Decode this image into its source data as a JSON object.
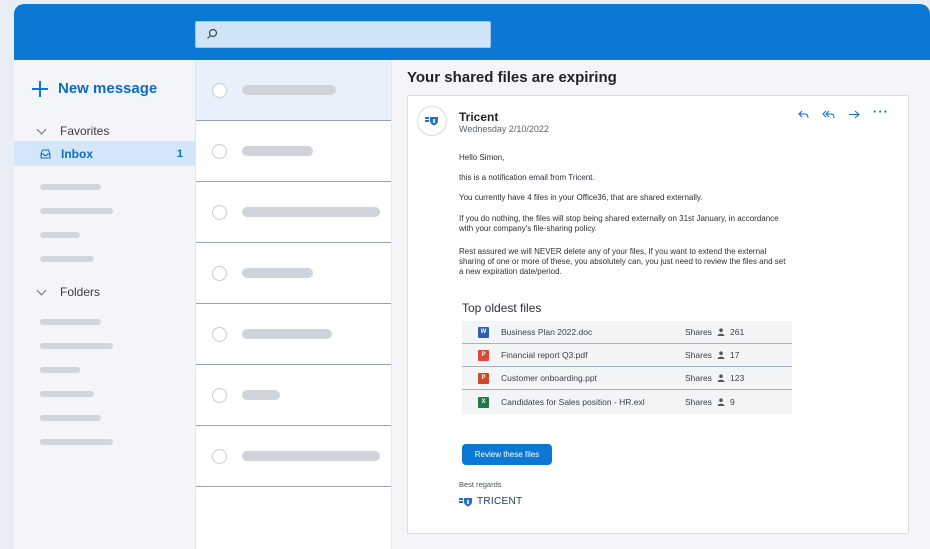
{
  "sidebar": {
    "new_message": "New message",
    "favorites": "Favorites",
    "inbox": {
      "label": "Inbox",
      "count": "1"
    },
    "folders": "Folders"
  },
  "email": {
    "subject": "Your shared files are expiring",
    "sender": "Tricent",
    "date": "Wednesday 2/10/2022",
    "greeting": "Hello Simon,",
    "para1": "this is a notification email from Tricent.",
    "para2": "You currently have 4 files in your Office36, that are shared externally.",
    "para3": "If you do nothing, the files will stop being shared externally on 31st January, in accordance with your company's file-sharing policy.",
    "para4": "Rest assured we will NEVER delete any of your files, If you want to extend the external sharing of one or more of these, you absolutely can, you just need to review the files and set a new expiration date/period.",
    "files_title": "Top oldest files",
    "files": [
      {
        "name": "Business Plan 2022.doc",
        "shares_label": "Shares",
        "count": "261",
        "icon": "word-icon",
        "color": "#2b5fb4"
      },
      {
        "name": "Financial report Q3.pdf",
        "shares_label": "Shares",
        "count": "17",
        "icon": "pdf-icon",
        "color": "#e0473b"
      },
      {
        "name": "Customer onboarding.ppt",
        "shares_label": "Shares",
        "count": "123",
        "icon": "powerpoint-icon",
        "color": "#d04a2a"
      },
      {
        "name": "Candidates for Sales position - HR.exl",
        "shares_label": "Shares",
        "count": "9",
        "icon": "excel-icon",
        "color": "#1f7a46"
      }
    ],
    "review_button": "Review these files",
    "regards": "Best regards",
    "signature": "TRICENT"
  },
  "colors": {
    "brand": "#0b78d4",
    "accent_text": "#0b6cc4"
  }
}
